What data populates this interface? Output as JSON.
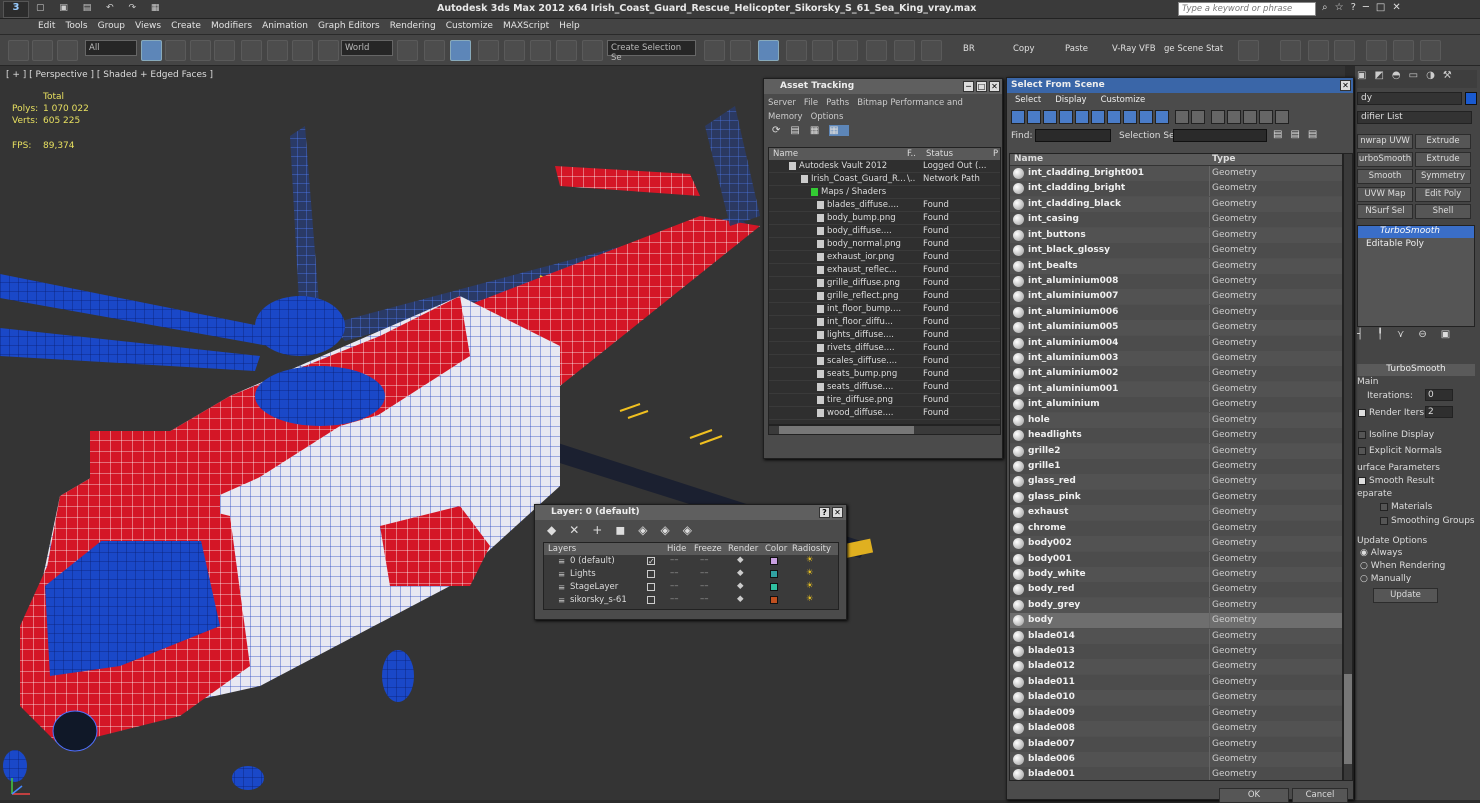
{
  "app": {
    "title": "Autodesk 3ds Max  2012 x64     Irish_Coast_Guard_Rescue_Helicopter_Sikorsky_S_61_Sea_King_vray.max",
    "search_placeholder": "Type a keyword or phrase"
  },
  "menu": [
    "Edit",
    "Tools",
    "Group",
    "Views",
    "Create",
    "Modifiers",
    "Animation",
    "Graph Editors",
    "Rendering",
    "Customize",
    "MAXScript",
    "Help"
  ],
  "toolbar": {
    "selection_filter": "All",
    "ref_coord": "World",
    "named_selection": "Create Selection Se",
    "br": "BR",
    "copy": "Copy",
    "paste": "Paste",
    "vray_vfb": "V-Ray VFB",
    "scene_states": "ge Scene Stat"
  },
  "viewport": {
    "label": "[ + ] [ Perspective ] [ Shaded + Edged Faces ]",
    "stats": {
      "total_label": "Total",
      "polys_label": "Polys:",
      "polys": "1 070 022",
      "verts_label": "Verts:",
      "verts": "605 225",
      "fps_label": "FPS:",
      "fps": "89,374"
    }
  },
  "asset_tracking": {
    "title": "Asset Tracking",
    "menu": [
      "Server",
      "File",
      "Paths",
      "Bitmap Performance and Memory",
      "Options"
    ],
    "columns": [
      "Name",
      "F..",
      "Status",
      "P"
    ],
    "rows": [
      {
        "name": "Autodesk Vault 2012",
        "f": "",
        "status": "Logged Out (..."
      },
      {
        "name": "Irish_Coast_Guard_R...",
        "f": "\\..",
        "status": "Network Path"
      },
      {
        "name": "Maps / Shaders",
        "f": "",
        "status": ""
      },
      {
        "name": "blades_diffuse....",
        "f": "",
        "status": "Found"
      },
      {
        "name": "body_bump.png",
        "f": "",
        "status": "Found"
      },
      {
        "name": "body_diffuse....",
        "f": "",
        "status": "Found"
      },
      {
        "name": "body_normal.png",
        "f": "",
        "status": "Found"
      },
      {
        "name": "exhaust_ior.png",
        "f": "",
        "status": "Found"
      },
      {
        "name": "exhaust_reflec...",
        "f": "",
        "status": "Found"
      },
      {
        "name": "grille_diffuse.png",
        "f": "",
        "status": "Found"
      },
      {
        "name": "grille_reflect.png",
        "f": "",
        "status": "Found"
      },
      {
        "name": "int_floor_bump....",
        "f": "",
        "status": "Found"
      },
      {
        "name": "int_floor_diffu...",
        "f": "",
        "status": "Found"
      },
      {
        "name": "lights_diffuse....",
        "f": "",
        "status": "Found"
      },
      {
        "name": "rivets_diffuse....",
        "f": "",
        "status": "Found"
      },
      {
        "name": "scales_diffuse....",
        "f": "",
        "status": "Found"
      },
      {
        "name": "seats_bump.png",
        "f": "",
        "status": "Found"
      },
      {
        "name": "seats_diffuse....",
        "f": "",
        "status": "Found"
      },
      {
        "name": "tire_diffuse.png",
        "f": "",
        "status": "Found"
      },
      {
        "name": "wood_diffuse....",
        "f": "",
        "status": "Found"
      }
    ]
  },
  "layer": {
    "title": "Layer: 0 (default)",
    "columns": [
      "Layers",
      "Hide",
      "Freeze",
      "Render",
      "Color",
      "Radiosity"
    ],
    "rows": [
      {
        "name": "0 (default)",
        "color": "#c8a0e0"
      },
      {
        "name": "Lights",
        "color": "#30a0a0"
      },
      {
        "name": "StageLayer",
        "color": "#30c0a0"
      },
      {
        "name": "sikorsky_s-61",
        "color": "#c05020"
      }
    ]
  },
  "select_from_scene": {
    "title": "Select From Scene",
    "menu": [
      "Select",
      "Display",
      "Customize"
    ],
    "find_label": "Find:",
    "selection_set_label": "Selection Set:",
    "col_name": "Name",
    "col_type": "Type",
    "ok": "OK",
    "cancel": "Cancel",
    "rows": [
      {
        "name": "int_cladding_bright001",
        "type": "Geometry"
      },
      {
        "name": "int_cladding_bright",
        "type": "Geometry"
      },
      {
        "name": "int_cladding_black",
        "type": "Geometry"
      },
      {
        "name": "int_casing",
        "type": "Geometry"
      },
      {
        "name": "int_buttons",
        "type": "Geometry"
      },
      {
        "name": "int_black_glossy",
        "type": "Geometry"
      },
      {
        "name": "int_bealts",
        "type": "Geometry"
      },
      {
        "name": "int_aluminium008",
        "type": "Geometry"
      },
      {
        "name": "int_aluminium007",
        "type": "Geometry"
      },
      {
        "name": "int_aluminium006",
        "type": "Geometry"
      },
      {
        "name": "int_aluminium005",
        "type": "Geometry"
      },
      {
        "name": "int_aluminium004",
        "type": "Geometry"
      },
      {
        "name": "int_aluminium003",
        "type": "Geometry"
      },
      {
        "name": "int_aluminium002",
        "type": "Geometry"
      },
      {
        "name": "int_aluminium001",
        "type": "Geometry"
      },
      {
        "name": "int_aluminium",
        "type": "Geometry"
      },
      {
        "name": "hole",
        "type": "Geometry"
      },
      {
        "name": "headlights",
        "type": "Geometry"
      },
      {
        "name": "grille2",
        "type": "Geometry"
      },
      {
        "name": "grille1",
        "type": "Geometry"
      },
      {
        "name": "glass_red",
        "type": "Geometry"
      },
      {
        "name": "glass_pink",
        "type": "Geometry"
      },
      {
        "name": "exhaust",
        "type": "Geometry"
      },
      {
        "name": "chrome",
        "type": "Geometry"
      },
      {
        "name": "body002",
        "type": "Geometry"
      },
      {
        "name": "body001",
        "type": "Geometry"
      },
      {
        "name": "body_white",
        "type": "Geometry"
      },
      {
        "name": "body_red",
        "type": "Geometry"
      },
      {
        "name": "body_grey",
        "type": "Geometry"
      },
      {
        "name": "body",
        "type": "Geometry"
      },
      {
        "name": "blade014",
        "type": "Geometry"
      },
      {
        "name": "blade013",
        "type": "Geometry"
      },
      {
        "name": "blade012",
        "type": "Geometry"
      },
      {
        "name": "blade011",
        "type": "Geometry"
      },
      {
        "name": "blade010",
        "type": "Geometry"
      },
      {
        "name": "blade009",
        "type": "Geometry"
      },
      {
        "name": "blade008",
        "type": "Geometry"
      },
      {
        "name": "blade007",
        "type": "Geometry"
      },
      {
        "name": "blade006",
        "type": "Geometry"
      },
      {
        "name": "blade001",
        "type": "Geometry"
      }
    ],
    "selected_index": 29
  },
  "command_panel": {
    "name_field": "dy",
    "modifier_list": "difier List",
    "buttons": [
      "nwrap UVW",
      "Extrude",
      "urboSmooth",
      "Extrude",
      "Smooth",
      "Symmetry",
      "UVW Map",
      "Edit Poly",
      "NSurf Sel",
      "Shell"
    ],
    "stack": [
      "TurboSmooth",
      "Editable Poly"
    ],
    "rollout_title": "TurboSmooth",
    "main_label": "Main",
    "iterations_label": "Iterations:",
    "iterations": "0",
    "render_iters_label": "Render Iters:",
    "render_iters": "2",
    "isoline": "Isoline Display",
    "explicit_normals": "Explicit Normals",
    "surface_params": "urface Parameters",
    "smooth_result": "Smooth Result",
    "separate": "eparate",
    "materials": "Materials",
    "smoothing_groups": "Smoothing Groups",
    "update_options": "Update Options",
    "always": "Always",
    "when_rendering": "When Rendering",
    "manually": "Manually",
    "update": "Update"
  },
  "colors": {
    "body_red": "#d01020",
    "wire_blue": "#1840c0",
    "selected_row": "#6e6e6e"
  }
}
